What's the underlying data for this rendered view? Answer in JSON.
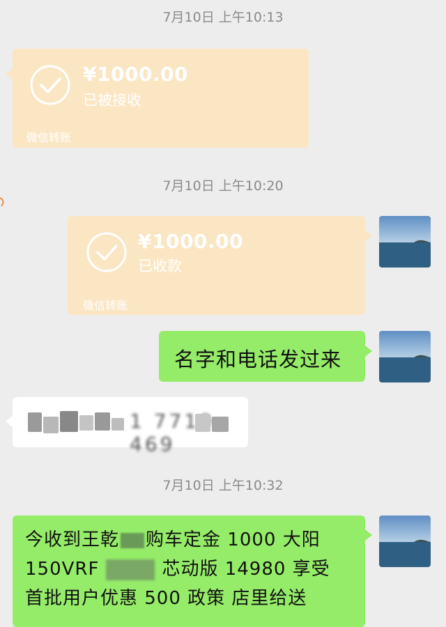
{
  "timestamps": [
    "7月10日 上午10:13",
    "7月10日 上午10:20",
    "7月10日 上午10:32"
  ],
  "transfer_received": {
    "amount": "¥1000.00",
    "status": "已被接收",
    "footer": "微信转账"
  },
  "transfer_sent": {
    "amount": "¥1000.00",
    "status": "已收款",
    "footer": "微信转账"
  },
  "message_request": "名字和电话发过来",
  "message_reply_blurred": "1 7719 469",
  "message_receipt": {
    "line1_prefix": "今收到王乾",
    "line1_suffix": "购车定金 1000  大阳",
    "line2_prefix": "150VRF",
    "line2_suffix": "芯动版  14980  享受",
    "line3": "首批用户优惠 500 政策  店里给送"
  },
  "colors": {
    "background": "#ededed",
    "green_bubble": "#95ec69",
    "transfer_card": "#fbe6c3",
    "timestamp": "#8a8a8a"
  },
  "icons": [
    "check-circle-icon",
    "avatar-sea-image"
  ]
}
